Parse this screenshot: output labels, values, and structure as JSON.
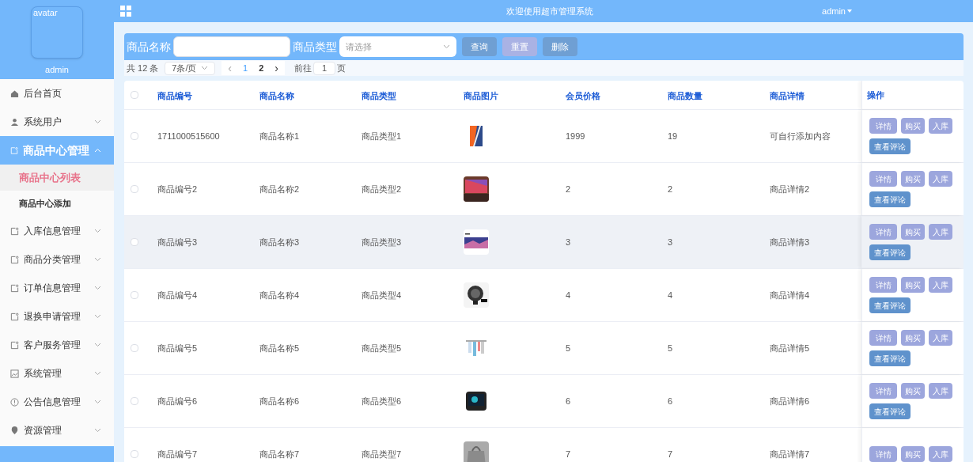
{
  "header": {
    "title": "欢迎使用超市管理系统",
    "user": "admin"
  },
  "sidebar": {
    "avatar_alt": "avatar",
    "username": "admin",
    "items": [
      {
        "label": "后台首页",
        "expanded": false,
        "has_children": false
      },
      {
        "label": "系统用户",
        "expanded": false,
        "has_children": true
      },
      {
        "label": "商品中心管理",
        "expanded": true,
        "has_children": true,
        "children": [
          {
            "label": "商品中心列表",
            "selected": true
          },
          {
            "label": "商品中心添加",
            "selected": false
          }
        ]
      },
      {
        "label": "入库信息管理",
        "expanded": false,
        "has_children": true
      },
      {
        "label": "商品分类管理",
        "expanded": false,
        "has_children": true
      },
      {
        "label": "订单信息管理",
        "expanded": false,
        "has_children": true
      },
      {
        "label": "退换申请管理",
        "expanded": false,
        "has_children": true
      },
      {
        "label": "客户服务管理",
        "expanded": false,
        "has_children": true
      },
      {
        "label": "系统管理",
        "expanded": false,
        "has_children": true
      },
      {
        "label": "公告信息管理",
        "expanded": false,
        "has_children": true
      },
      {
        "label": "资源管理",
        "expanded": false,
        "has_children": true
      }
    ]
  },
  "search": {
    "name_label": "商品名称",
    "type_label": "商品类型",
    "type_placeholder": "请选择",
    "buttons": [
      "查询",
      "重置",
      "删除"
    ]
  },
  "pagination": {
    "total": "共 12 条",
    "page_size": "7条/页",
    "prev": "‹",
    "pages": [
      {
        "label": "1",
        "selected": true
      },
      {
        "label": "2",
        "selected": false
      }
    ],
    "next": "›",
    "goto_label": "前往",
    "goto_value": "1",
    "goto_suffix": "页"
  },
  "table": {
    "select_all_checked": false,
    "columns": [
      "商品编号",
      "商品名称",
      "商品类型",
      "商品图片",
      "会员价格",
      "商品数量",
      "商品详情",
      "操作"
    ],
    "rows": [
      {
        "code": "1711000515600",
        "name": "商品名称1",
        "type": "商品类型1",
        "price": "1999",
        "quantity": "19",
        "detail": "可自行添加内容",
        "highlighted": false,
        "actions": [
          "详情",
          "购买",
          "入库",
          "查看评论"
        ]
      },
      {
        "code": "商品编号2",
        "name": "商品名称2",
        "type": "商品类型2",
        "price": "2",
        "quantity": "2",
        "detail": "商品详情2",
        "highlighted": false,
        "actions": [
          "详情",
          "购买",
          "入库",
          "查看评论"
        ]
      },
      {
        "code": "商品编号3",
        "name": "商品名称3",
        "type": "商品类型3",
        "price": "3",
        "quantity": "3",
        "detail": "商品详情3",
        "highlighted": true,
        "actions": [
          "详情",
          "购买",
          "入库",
          "查看评论"
        ]
      },
      {
        "code": "商品编号4",
        "name": "商品名称4",
        "type": "商品类型4",
        "price": "4",
        "quantity": "4",
        "detail": "商品详情4",
        "highlighted": false,
        "actions": [
          "详情",
          "购买",
          "入库",
          "查看评论"
        ]
      },
      {
        "code": "商品编号5",
        "name": "商品名称5",
        "type": "商品类型5",
        "price": "5",
        "quantity": "5",
        "detail": "商品详情5",
        "highlighted": false,
        "actions": [
          "详情",
          "购买",
          "入库",
          "查看评论"
        ]
      },
      {
        "code": "商品编号6",
        "name": "商品名称6",
        "type": "商品类型6",
        "price": "6",
        "quantity": "6",
        "detail": "商品详情6",
        "highlighted": false,
        "actions": [
          "详情",
          "购买",
          "入库",
          "查看评论"
        ]
      },
      {
        "code": "商品编号7",
        "name": "商品名称7",
        "type": "商品类型7",
        "price": "7",
        "quantity": "7",
        "detail": "商品详情7",
        "highlighted": false,
        "actions": [
          "详情",
          "购买",
          "入库"
        ]
      }
    ]
  }
}
